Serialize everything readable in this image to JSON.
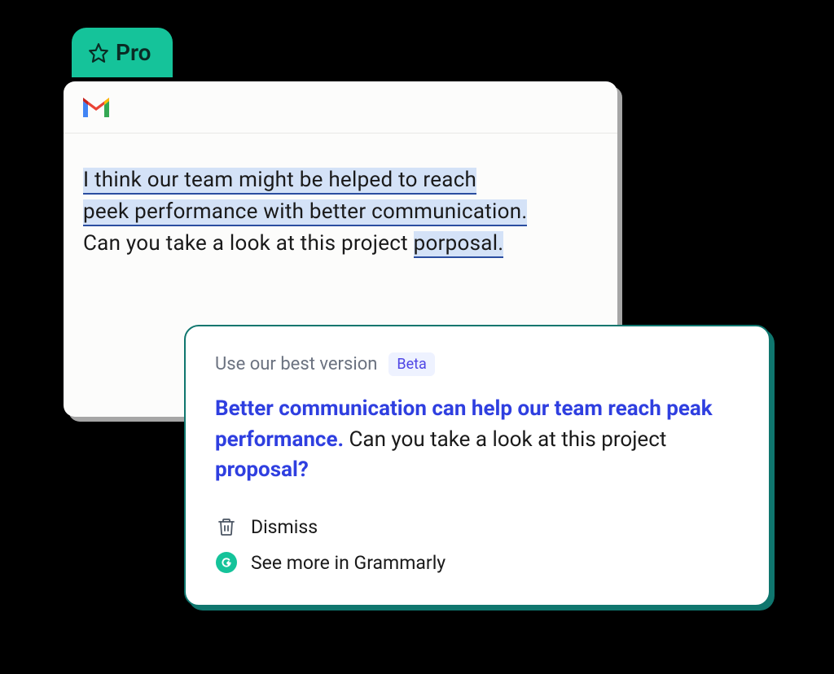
{
  "badge": {
    "label": "Pro"
  },
  "draft": {
    "highlight_line1": "I think our team might be helped to reach",
    "highlight_line2": "peek performance with better communication.",
    "plain_line3_before": "Can you take a look at this project ",
    "highlight_word": "porposal.",
    "plain_line3_after": ""
  },
  "suggestion": {
    "header_title": "Use our best version",
    "beta_label": "Beta",
    "rewrite_part1": "Better communication can help our team reach peak performance.",
    "plain_part2": " Can you take a look at this project ",
    "rewrite_part3": "proposal?",
    "dismiss_label": "Dismiss",
    "more_label": "See more in Grammarly"
  }
}
